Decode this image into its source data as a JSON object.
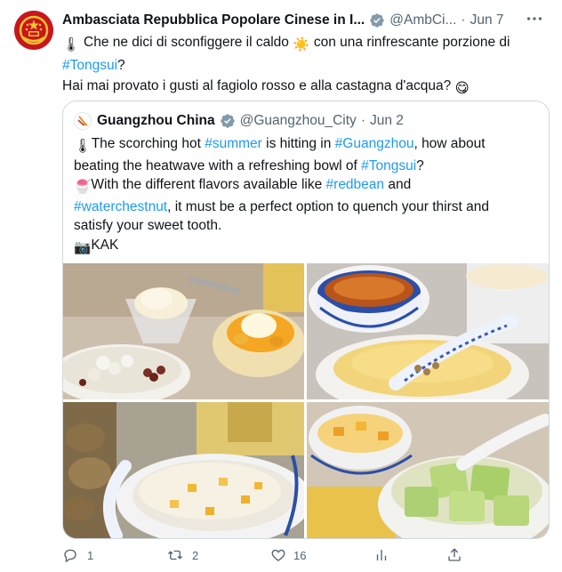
{
  "tweet": {
    "author_name": "Ambasciata Repubblica Popolare Cinese in I...",
    "author_handle": "@AmbCi...",
    "separator": "·",
    "date": "Jun 7",
    "text_line1_a": "Che ne dici di sconfiggere il caldo",
    "text_line1_b": "con una rinfrescante porzione di",
    "hashtag_tongsui": "#Tongsui",
    "text_line2_tail": "?",
    "text_line3": "Hai mai provato i gusti al fagiolo rosso e alla castagna d'acqua?",
    "emoji_thermometer": "🌡",
    "emoji_sun": "☀️",
    "emoji_yum": "😋"
  },
  "quote": {
    "author_name": "Guangzhou China",
    "author_handle": "@Guangzhou_City",
    "separator": "·",
    "date": "Jun 2",
    "emoji_thermometer": "🌡",
    "l1_a": "The scorching hot ",
    "h_summer": "#summer",
    "l1_b": " is hitting in ",
    "h_guangzhou": "#Guangzhou",
    "l1_c": ", how about",
    "l2_a": "beating the heatwave with a refreshing bowl of ",
    "h_tongsui": "#Tongsui",
    "l2_b": "?",
    "emoji_dessert": "🍧",
    "l3_a": "With the different flavors available like ",
    "h_redbean": "#redbean",
    "l3_b": " and",
    "h_waterchestnut": "#waterchestnut",
    "l4_b": ", it must be a perfect option to quench your thirst and",
    "l5": "satisfy your sweet tooth.",
    "emoji_camera": "📷",
    "credit": "KAK"
  },
  "actions": {
    "replies": "1",
    "retweets": "2",
    "likes": "",
    "views": "16"
  },
  "colors": {
    "text": "#0f1419",
    "muted": "#536471",
    "link": "#1d9bf0",
    "verified": "#829aab",
    "border": "#cfd9de",
    "avatar_red": "#c8161d"
  },
  "icons": [
    "more-icon",
    "verified-badge-icon",
    "reply-icon",
    "retweet-icon",
    "like-icon",
    "views-icon",
    "share-icon"
  ]
}
